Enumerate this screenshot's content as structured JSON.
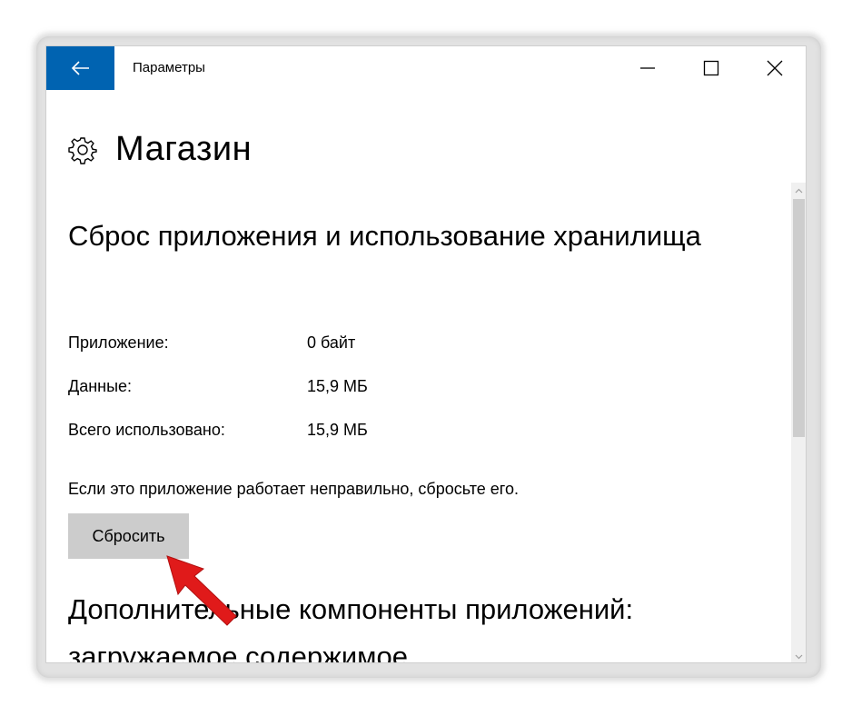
{
  "window": {
    "title": "Параметры"
  },
  "page": {
    "title": "Магазин"
  },
  "storage": {
    "section_title": "Сброс приложения и использование хранилища",
    "rows": [
      {
        "label": "Приложение:",
        "value": "0 байт"
      },
      {
        "label": "Данные:",
        "value": "15,9 МБ"
      },
      {
        "label": "Всего использовано:",
        "value": "15,9 МБ"
      }
    ],
    "hint": "Если это приложение работает неправильно, сбросьте его.",
    "reset_label": "Сбросить"
  },
  "addons": {
    "section_title": "Дополнительные компоненты приложений: загружаемое содержимое"
  },
  "colors": {
    "accent": "#0063b1",
    "button_bg": "#cccccc",
    "annotation_arrow": "#e01a1a"
  },
  "icons": {
    "back": "arrow-left-icon",
    "settings": "gear-icon",
    "minimize": "minimize-icon",
    "maximize": "maximize-icon",
    "close": "close-icon"
  }
}
